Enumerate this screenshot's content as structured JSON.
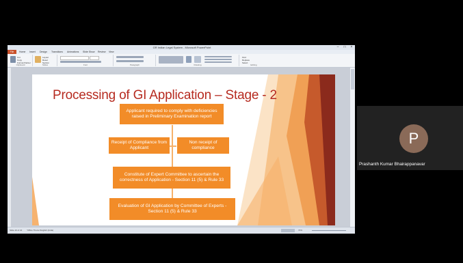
{
  "window": {
    "title": "GR Indian Legal System - Microsoft PowerPoint",
    "controls": {
      "minimize": "–",
      "maximize": "□",
      "close": "×"
    }
  },
  "ribbon": {
    "tabs": [
      "File",
      "Home",
      "Insert",
      "Design",
      "Transitions",
      "Animations",
      "Slide Show",
      "Review",
      "View"
    ],
    "groups": [
      "Clipboard",
      "Slides",
      "Font",
      "Paragraph",
      "Drawing",
      "Editing"
    ],
    "buttons": {
      "cut": "Cut",
      "copy": "Copy",
      "format_painter": "Format Painter",
      "new_slide": "New Slide",
      "layout": "Layout",
      "reset": "Reset",
      "section": "Section",
      "find": "Find",
      "replace": "Replace",
      "select": "Select"
    }
  },
  "slide": {
    "title": "Processing of GI Application – Stage - 2",
    "boxes": {
      "top": "Applicant required to comply with deficiencies raised in Preliminary Examination report",
      "left": "Receipt of Compliance from Applicant",
      "right": "Non receipt of compliance",
      "middle": "Constitute of Expert Committee to ascertain the correctness of Application - Section 11 (5) & Rule 33",
      "bottom": "Evaluation of GI Application by Committee of Experts - Section 11 (5) & Rule 33"
    },
    "colors": {
      "accent": "#f28c28",
      "title": "#b62a1f",
      "decor_dark": "#8b2a1c",
      "decor_light": "#f7c38a"
    }
  },
  "statusbar": {
    "slide_info": "Slide 10 of 22",
    "theme": "\"Office Theme\"",
    "language": "English (India)",
    "zoom": "74%"
  },
  "participant": {
    "initial": "P",
    "name": "Prashanth Kumar Bhairappanavar"
  }
}
